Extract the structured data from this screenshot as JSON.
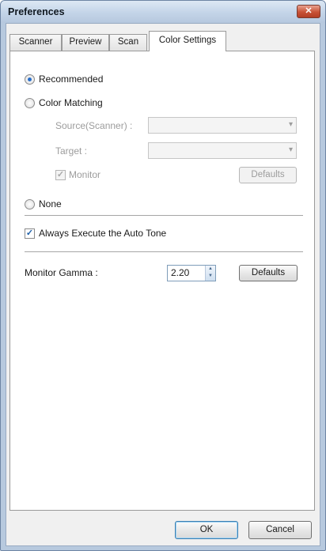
{
  "window": {
    "title": "Preferences",
    "close_glyph": "✕"
  },
  "tabs": [
    {
      "label": "Scanner",
      "active": false
    },
    {
      "label": "Preview",
      "active": false
    },
    {
      "label": "Scan",
      "active": false
    },
    {
      "label": "Color Settings",
      "active": true
    }
  ],
  "color_settings": {
    "recommended_label": "Recommended",
    "recommended_selected": true,
    "color_matching_label": "Color Matching",
    "color_matching_selected": false,
    "source_label": "Source(Scanner) :",
    "source_value": "",
    "target_label": "Target :",
    "target_value": "",
    "monitor_label": "Monitor",
    "monitor_checked": true,
    "defaults_label": "Defaults",
    "none_label": "None",
    "none_selected": false,
    "auto_tone_label": "Always Execute the Auto Tone",
    "auto_tone_checked": true,
    "monitor_gamma_label": "Monitor Gamma :",
    "monitor_gamma_value": "2.20",
    "gamma_defaults_label": "Defaults"
  },
  "footer": {
    "ok_label": "OK",
    "cancel_label": "Cancel"
  },
  "icons": {
    "combo_arrow": "chevron-down-icon",
    "check": "checkmark-icon",
    "close": "close-icon",
    "spinner": "up-down-spinner-icon"
  },
  "colors": {
    "title_bar": "#c3d4e8",
    "close_button": "#c85236",
    "radio_dot": "#2a6fc9"
  }
}
